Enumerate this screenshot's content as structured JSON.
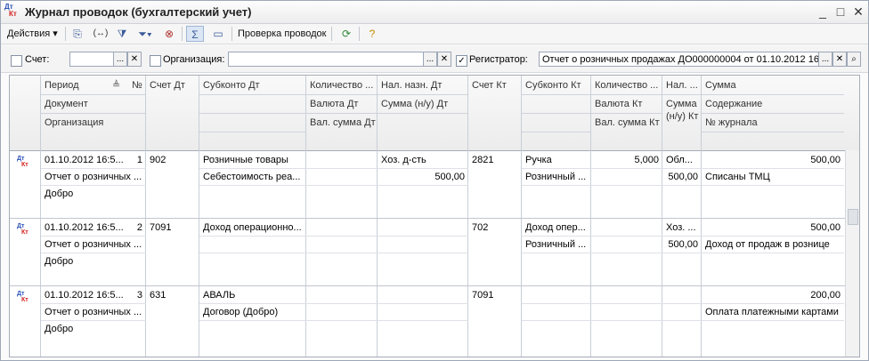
{
  "window": {
    "title": "Журнал проводок (бухгалтерский учет)",
    "icon_top": "Дт",
    "icon_bottom": "Кт",
    "controls": [
      "_",
      "□",
      "✕"
    ]
  },
  "toolbar": {
    "actions_label": "Действия",
    "check_label": "Проверка проводок"
  },
  "filters": {
    "account_label": "Счет:",
    "account_checked": false,
    "org_label": "Организация:",
    "org_checked": false,
    "registrar_label": "Регистратор:",
    "registrar_checked": true,
    "registrar_value": "Отчет о розничных продажах ДО000000004 от 01.10.2012 16:",
    "dots": "...",
    "clear": "✕",
    "search": "🔍"
  },
  "headers": {
    "period": "Период",
    "num": "№",
    "account_dt": "Счет Дт",
    "subconto_dt": "Субконто Дт",
    "qty_dt": "Количество ...",
    "tax_dt": "Нал. назн. Дт",
    "account_kt": "Счет Кт",
    "subconto_kt": "Субконто Кт",
    "qty_kt": "Количество ...",
    "tax_kt": "Нал. ...",
    "sum": "Сумма",
    "document": "Документ",
    "currency_dt": "Валюта Дт",
    "sum_nu_dt": "Сумма (н/у) Дт",
    "currency_kt": "Валюта Кт",
    "sum_nu_kt": "Сумма (н/у) Кт",
    "content": "Содержание",
    "organization": "Организация",
    "val_sum_dt": "Вал. сумма Дт",
    "val_sum_kt": "Вал. сумма Кт",
    "journal_no": "№ журнала"
  },
  "rows": [
    {
      "icon_top": "Дт",
      "icon_bottom": "Кт",
      "period": "01.10.2012 16:5...",
      "num": "1",
      "account_dt": "902",
      "subconto_dt_1": "Розничные товары",
      "subconto_dt_2": "Себестоимость реа...",
      "tax_dt": "Хоз. д-сть",
      "sum_nu_dt": "500,00",
      "account_kt": "2821",
      "subconto_kt_1": "Ручка",
      "subconto_kt_2": "Розничный ...",
      "qty_kt": "5,000",
      "tax_kt": "Обл...",
      "sum_nu_kt": "500,00",
      "sum": "500,00",
      "content": "Списаны ТМЦ",
      "document": "Отчет о розничных ...",
      "organization": "Добро"
    },
    {
      "icon_top": "Дт",
      "icon_bottom": "Кт",
      "period": "01.10.2012 16:5...",
      "num": "2",
      "account_dt": "7091",
      "subconto_dt_1": "Доход операционно...",
      "subconto_dt_2": "",
      "tax_dt": "",
      "sum_nu_dt": "",
      "account_kt": "702",
      "subconto_kt_1": "Доход опер...",
      "subconto_kt_2": "Розничный ...",
      "qty_kt": "",
      "tax_kt": "Хоз. ...",
      "sum_nu_kt": "500,00",
      "sum": "500,00",
      "content": "Доход от продаж в рознице",
      "document": "Отчет о розничных ...",
      "organization": "Добро"
    },
    {
      "icon_top": "Дт",
      "icon_bottom": "Кт",
      "period": "01.10.2012 16:5...",
      "num": "3",
      "account_dt": "631",
      "subconto_dt_1": "АВАЛЬ",
      "subconto_dt_2": "Договор (Добро)",
      "tax_dt": "",
      "sum_nu_dt": "",
      "account_kt": "7091",
      "subconto_kt_1": "",
      "subconto_kt_2": "",
      "qty_kt": "",
      "tax_kt": "",
      "sum_nu_kt": "",
      "sum": "200,00",
      "content": "Оплата платежными картами",
      "document": "Отчет о розничных ...",
      "organization": "Добро"
    }
  ]
}
